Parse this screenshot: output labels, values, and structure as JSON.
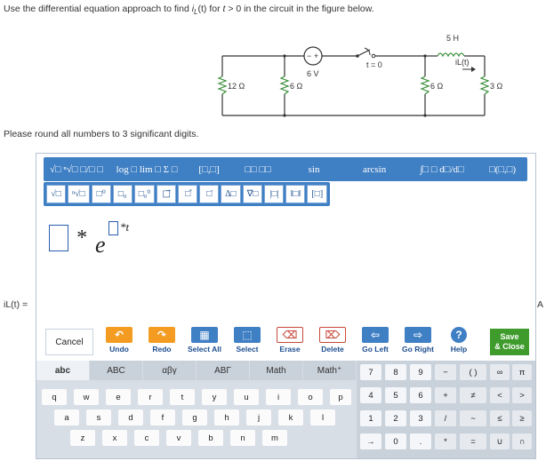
{
  "question": {
    "prefix": "Use the differential equation approach to find ",
    "variable": "i",
    "variable_sub": "L",
    "variable_arg": "(t)",
    "middle": " for ",
    "condition_var": "t",
    "suffix": " > 0 in the circuit in the figure below."
  },
  "circuit": {
    "resistor_12": "12 Ω",
    "resistor_6a": "6 Ω",
    "source": "6 V",
    "switch": "t = 0",
    "inductor": "5 H",
    "il": "iL(t)",
    "resistor_6b": "6 Ω",
    "resistor_3": "3 Ω"
  },
  "round_note": "Please round all numbers to 3 significant digits.",
  "answer_label": "iL(t) =",
  "right_cut_label": "A",
  "templates": {
    "row1": [
      "√□ ⁿ√□ □/□ □",
      "log □  lim □  Σ □",
      "[□,□]",
      "□□ □□",
      "sin",
      "arcsin",
      "∫□ □  d□/d□",
      "□(□,□)"
    ],
    "row2": [
      "√□",
      "ⁿ√□",
      "□⁰",
      "□₀",
      "□₀⁰",
      "□⃗",
      "□̂",
      "□̇",
      "Δ□",
      "∇□",
      "|□|",
      "‖□‖",
      "[□]"
    ]
  },
  "math": {
    "times1": "*",
    "base": "e",
    "times2": "*t"
  },
  "actions": {
    "cancel": "Cancel",
    "undo": "Undo",
    "redo": "Redo",
    "select_all": "Select All",
    "select": "Select",
    "erase": "Erase",
    "delete": "Delete",
    "go_left": "Go Left",
    "go_right": "Go Right",
    "help": "Help",
    "save_close_1": "Save",
    "save_close_2": "& Close"
  },
  "keyboard": {
    "tabs": [
      "abc",
      "ABC",
      "αβγ",
      "ΑΒΓ",
      "Math",
      "Math⁺"
    ],
    "row1": [
      "q",
      "w",
      "e",
      "r",
      "t",
      "y",
      "u",
      "i",
      "o",
      "p"
    ],
    "row2": [
      "a",
      "s",
      "d",
      "f",
      "g",
      "h",
      "j",
      "k",
      "l"
    ],
    "row3": [
      "z",
      "x",
      "c",
      "v",
      "b",
      "n",
      "m"
    ],
    "numpad": [
      [
        "7",
        "8",
        "9",
        "−",
        "( )",
        "∞",
        "π"
      ],
      [
        "4",
        "5",
        "6",
        "+",
        "≠",
        "<",
        ">"
      ],
      [
        "1",
        "2",
        "3",
        "/",
        "~",
        "≤",
        "≥"
      ],
      [
        "→",
        "0",
        ".",
        "*",
        "=",
        "∪",
        "∩"
      ]
    ]
  },
  "colors": {
    "accent_blue": "#3f7fc4",
    "orange": "#f39c21",
    "save_green": "#3f9c2c"
  }
}
